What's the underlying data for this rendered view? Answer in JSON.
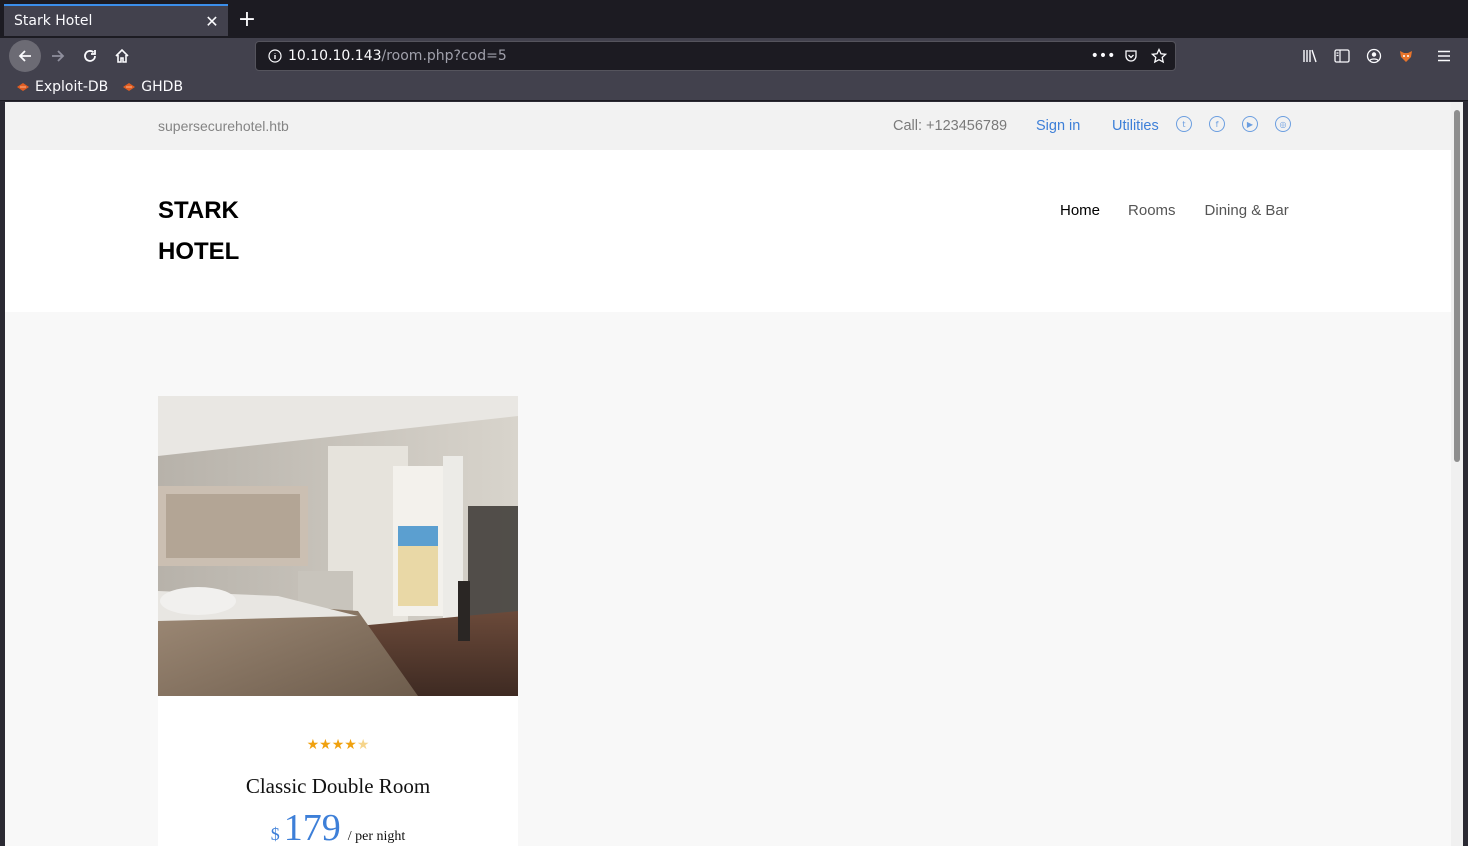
{
  "browser": {
    "tab_title": "Stark Hotel",
    "tab_close": "✕",
    "new_tab": "+",
    "url_host": "10.10.10.143",
    "url_path": "/room.php?cod=5",
    "bookmarks": [
      {
        "label": "Exploit-DB",
        "icon": "exploit-db-icon"
      },
      {
        "label": "GHDB",
        "icon": "ghdb-icon"
      }
    ],
    "accent_color": "#3b8eea"
  },
  "site": {
    "topbar": {
      "domain": "supersecurehotel.htb",
      "call": "Call: +123456789",
      "signin": "Sign in",
      "utilities": "Utilities",
      "social_icons": [
        "twitter-icon",
        "facebook-icon",
        "youtube-icon",
        "dribbble-icon"
      ]
    },
    "logo_line1": "STARK",
    "logo_line2": "HOTEL",
    "nav": {
      "home": "Home",
      "rooms": "Rooms",
      "dining": "Dining & Bar"
    },
    "room": {
      "rating": 4,
      "rating_max": 5,
      "name": "Classic Double Room",
      "currency": "$",
      "price": "179",
      "per": "/ per night"
    },
    "link_color": "#3d7fd8",
    "star_color": "#f0a10f"
  }
}
